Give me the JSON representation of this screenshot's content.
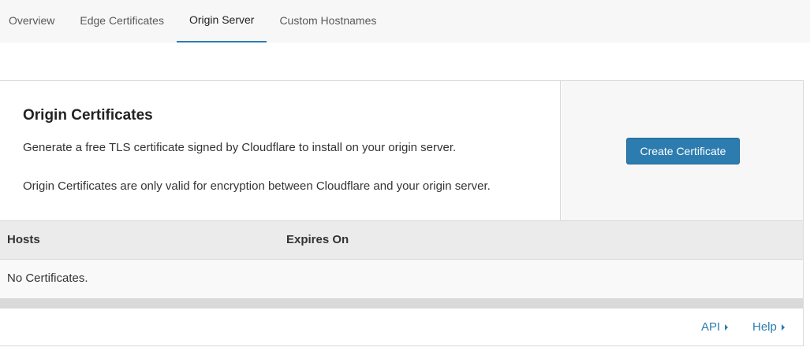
{
  "tabs": [
    {
      "label": "Overview",
      "active": false
    },
    {
      "label": "Edge Certificates",
      "active": false
    },
    {
      "label": "Origin Server",
      "active": true
    },
    {
      "label": "Custom Hostnames",
      "active": false
    }
  ],
  "origin_card": {
    "title": "Origin Certificates",
    "description": "Generate a free TLS certificate signed by Cloudflare to install on your origin server.",
    "note": "Origin Certificates are only valid for encryption between Cloudflare and your origin server.",
    "create_button_label": "Create Certificate"
  },
  "table": {
    "columns": [
      "Hosts",
      "Expires On"
    ],
    "empty_message": "No Certificates."
  },
  "footer": {
    "api_label": "API",
    "help_label": "Help"
  },
  "colors": {
    "accent": "#2c7cb0",
    "tab_bar_bg": "#f7f7f7",
    "table_header_bg": "#ebebeb"
  },
  "icons": {
    "link_caret": "caret-right-icon"
  }
}
